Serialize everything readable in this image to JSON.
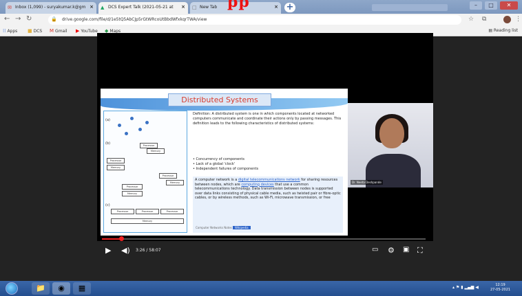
{
  "overlay": {
    "title_fragment": "pp"
  },
  "tabs": [
    {
      "title": "Inbox (1,099) - suryakumar.k@gm",
      "icon": "gmail-icon",
      "active": false
    },
    {
      "title": "DCS Expert Talk (2021-05-21 at",
      "icon": "drive-icon",
      "active": true
    },
    {
      "title": "New Tab",
      "icon": "newtab-icon",
      "active": false
    }
  ],
  "toolbar": {
    "url": "drive.google.com/file/d/1e5tQ5AbCJp5rGtWRcoUtBbdWfxkqrTWA/view"
  },
  "bookmarks": [
    {
      "label": "Apps",
      "icon": "apps-icon"
    },
    {
      "label": "DCS",
      "icon": "folder-icon"
    },
    {
      "label": "Gmail",
      "icon": "gmail-icon"
    },
    {
      "label": "YouTube",
      "icon": "youtube-icon"
    },
    {
      "label": "Maps",
      "icon": "maps-icon"
    }
  ],
  "reading_list": "Reading list",
  "slide": {
    "title": "Distributed Systems",
    "diagram": {
      "labels": [
        "(a)",
        "(b)",
        "(c)"
      ],
      "processor": "Processor",
      "memory": "Memory"
    },
    "definition": "Definition: A distributed system is one in which components located at networked computers communicate and coordinate their actions only by passing messages. This definition leads to the following characteristics of distributed systems:",
    "bullets": [
      "Concurrency of components",
      "Lack of a global 'clock'",
      "Independent failures of components"
    ],
    "network_text_1": "A computer network is a",
    "network_link_1": "digital telecommunications network",
    "network_text_2": "for sharing resources between nodes, which are",
    "network_link_2": "computing devices",
    "network_text_3": "that use a common telecommunications technology. Data transmission between nodes is supported over data links consisting of physical cable media, such as twisted pair or fibre-optic cables, or by wireless methods, such as Wi-Fi, microwave transmission, or free",
    "footer_text": "Computer Networks Notes",
    "footer_pill": "Wikipedia"
  },
  "webcam": {
    "name": "Dr. Neeta Deshpande"
  },
  "player": {
    "time": "3:26 / 58:07",
    "progress": 0.059
  },
  "taskbar": {
    "clock_time": "12:19",
    "clock_date": "27-05-2021"
  }
}
